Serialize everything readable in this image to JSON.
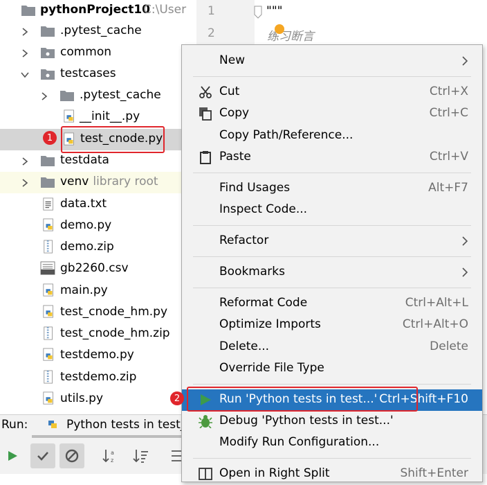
{
  "project": {
    "name": "pythonProject10",
    "path": "C:\\Users\\"
  },
  "tree": {
    "items": [
      {
        "label": ".pytest_cache"
      },
      {
        "label": "common"
      },
      {
        "label": "testcases"
      },
      {
        "label": ".pytest_cache"
      },
      {
        "label": "__init__.py"
      },
      {
        "label": "test_cnode.py"
      },
      {
        "label": "testdata"
      },
      {
        "label": "venv",
        "note": "library root"
      },
      {
        "label": "data.txt"
      },
      {
        "label": "demo.py"
      },
      {
        "label": "demo.zip"
      },
      {
        "label": "gb2260.csv"
      },
      {
        "label": "main.py"
      },
      {
        "label": "test_cnode_hm.py"
      },
      {
        "label": "test_cnode_hm.zip"
      },
      {
        "label": "testdemo.py"
      },
      {
        "label": "testdemo.zip"
      },
      {
        "label": "utils.py"
      }
    ]
  },
  "editor": {
    "line1": "1",
    "line2": "2",
    "code1": "\"\"\"",
    "code2": "练习断言"
  },
  "run": {
    "label": "Run:",
    "tab": "Python tests in test_c"
  },
  "menu": {
    "new": "New",
    "cut": "Cut",
    "cut_sc": "Ctrl+X",
    "copy": "Copy",
    "copy_sc": "Ctrl+C",
    "copy_path": "Copy Path/Reference...",
    "paste": "Paste",
    "paste_sc": "Ctrl+V",
    "find_usages": "Find Usages",
    "find_usages_sc": "Alt+F7",
    "inspect_code": "Inspect Code...",
    "refactor": "Refactor",
    "bookmarks": "Bookmarks",
    "reformat": "Reformat Code",
    "reformat_sc": "Ctrl+Alt+L",
    "optimize": "Optimize Imports",
    "optimize_sc": "Ctrl+Alt+O",
    "delete": "Delete...",
    "delete_sc": "Delete",
    "override": "Override File Type",
    "run": "Run 'Python tests in test...'",
    "run_sc": "Ctrl+Shift+F10",
    "debug": "Debug 'Python tests in test...'",
    "modify": "Modify Run Configuration...",
    "open_split": "Open in Right Split",
    "open_split_sc": "Shift+Enter"
  },
  "badges": {
    "one": "1",
    "two": "2"
  },
  "colors": {
    "selection": "#2675bf",
    "highlight_box": "#e0262c",
    "run_green": "#3d9b4a"
  }
}
